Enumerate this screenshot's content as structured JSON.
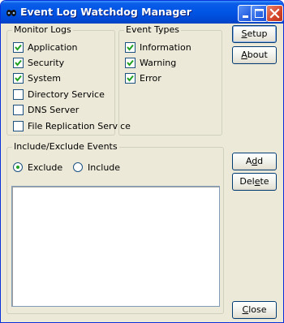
{
  "window": {
    "title": "Event Log Watchdog Manager",
    "colors": {
      "titlebar": "#0055E5",
      "face": "#ECE9D8",
      "close": "#D5452B"
    }
  },
  "monitor_logs": {
    "label": "Monitor Logs",
    "items": [
      {
        "label": "Application",
        "checked": true
      },
      {
        "label": "Security",
        "checked": true
      },
      {
        "label": "System",
        "checked": true
      },
      {
        "label": "Directory Service",
        "checked": false
      },
      {
        "label": "DNS Server",
        "checked": false
      },
      {
        "label": "File Replication Service",
        "checked": false
      }
    ]
  },
  "event_types": {
    "label": "Event Types",
    "items": [
      {
        "label": "Information",
        "checked": true
      },
      {
        "label": "Warning",
        "checked": true
      },
      {
        "label": "Error",
        "checked": true
      }
    ]
  },
  "include_exclude": {
    "label": "Include/Exclude Events",
    "options": [
      {
        "label": "Exclude",
        "selected": true
      },
      {
        "label": "Include",
        "selected": false
      }
    ]
  },
  "buttons": {
    "setup": {
      "pre": "",
      "mn": "S",
      "post": "etup"
    },
    "about": {
      "pre": "",
      "mn": "A",
      "post": "bout"
    },
    "add": {
      "pre": "A",
      "mn": "d",
      "post": "d"
    },
    "delete": {
      "pre": "Del",
      "mn": "e",
      "post": "te"
    },
    "close": {
      "pre": "",
      "mn": "C",
      "post": "lose"
    }
  }
}
